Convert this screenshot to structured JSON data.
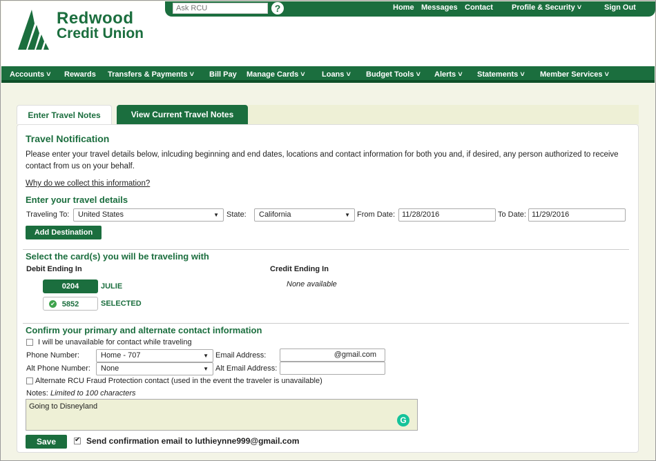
{
  "brand": {
    "line1": "Redwood",
    "line2": "Credit Union",
    "color": "#1b6e3e"
  },
  "topbar": {
    "search_placeholder": "Ask RCU",
    "help": "?",
    "links": [
      "Home",
      "Messages",
      "Contact",
      "Profile & Security ˅",
      "Sign Out"
    ]
  },
  "nav": {
    "items": [
      "Accounts ˅",
      "Rewards",
      "Transfers & Payments ˅",
      "Bill Pay",
      "Manage Cards ˅",
      "Loans ˅",
      "Budget Tools ˅",
      "Alerts ˅",
      "Statements ˅",
      "Member Services ˅"
    ]
  },
  "tabs": {
    "active": "Enter Travel Notes",
    "inactive": "View Current Travel Notes"
  },
  "travel": {
    "title": "Travel Notification",
    "intro": "Please enter your travel details below, inlcuding beginning and end dates, locations and contact information for both you and, if desired, any person authorized to receive contact from us on your behalf.",
    "why_link": "Why do we collect this information?",
    "details_heading": "Enter your travel details",
    "traveling_to_label": "Traveling To:",
    "traveling_to_value": "United States",
    "state_label": "State:",
    "state_value": "California",
    "from_label": "From Date:",
    "from_value": "11/28/2016",
    "to_label": "To Date:",
    "to_value": "11/29/2016",
    "add_destination": "Add Destination"
  },
  "cards": {
    "heading": "Select the card(s) you will be traveling with",
    "debit_header": "Debit Ending In",
    "credit_header": "Credit Ending In",
    "debit": [
      {
        "number": "0204",
        "status": "JULIE"
      },
      {
        "number": "5852",
        "status": "SELECTED"
      }
    ],
    "credit_empty": "None available"
  },
  "contact": {
    "heading": "Confirm your primary and alternate contact information",
    "unavailable_label": "I will be unavailable for contact while traveling",
    "phone_label": "Phone Number:",
    "phone_value": "Home - 707",
    "email_label": "Email Address:",
    "email_value": "@gmail.com",
    "alt_phone_label": "Alt Phone Number:",
    "alt_phone_value": "None",
    "alt_email_label": "Alt Email Address:",
    "alt_email_value": "",
    "fraud_label": "Alternate RCU Fraud Protection contact (used in the event the traveler is unavailable)",
    "notes_label": "Notes:",
    "notes_hint": "Limited to 100 characters",
    "notes_value": "Going to Disneyland",
    "grammarly": "G",
    "save": "Save",
    "confirm_email": "Send confirmation email to luthieynne999@gmail.com"
  }
}
